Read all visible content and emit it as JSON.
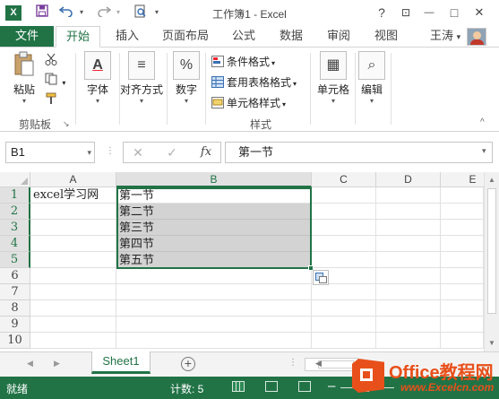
{
  "window": {
    "title": "工作簿1 - Excel",
    "app_icon": "X",
    "help": "?",
    "restore": "⊡",
    "minimize": "—",
    "maximize": "□",
    "close": "✕"
  },
  "ribbon_tabs": {
    "file": "文件",
    "items": [
      "开始",
      "插入",
      "页面布局",
      "公式",
      "数据",
      "审阅",
      "视图"
    ],
    "active": "开始",
    "user": "王涛",
    "user_caret": "▾"
  },
  "ribbon": {
    "clipboard": {
      "paste": "粘贴",
      "group": "剪贴板"
    },
    "font": {
      "label": "字体",
      "icon_text": "A"
    },
    "alignment": {
      "label": "对齐方式",
      "icon_text": "≡"
    },
    "number": {
      "label": "数字",
      "icon_text": "%"
    },
    "styles": {
      "conditional": "条件格式",
      "table": "套用表格格式",
      "cell_styles": "单元格样式",
      "group": "样式"
    },
    "cells": {
      "label": "单元格",
      "icon_text": "▦"
    },
    "editing": {
      "label": "编辑",
      "icon_text": "⌕"
    },
    "collapse": "^"
  },
  "formula_bar": {
    "name_box": "B1",
    "cancel": "✕",
    "enter": "✓",
    "fx": "fx",
    "value": "第一节"
  },
  "grid": {
    "columns": [
      "A",
      "B",
      "C",
      "D",
      "E"
    ],
    "rows": [
      "1",
      "2",
      "3",
      "4",
      "5",
      "6",
      "7",
      "8",
      "9",
      "10"
    ],
    "cells": {
      "A1": "excel学习网",
      "B1": "第一节",
      "B2": "第二节",
      "B3": "第三节",
      "B4": "第四节",
      "B5": "第五节"
    },
    "selection": "B1:B5"
  },
  "sheets": {
    "tabs": [
      "Sheet1"
    ],
    "active": "Sheet1",
    "add": "+"
  },
  "status": {
    "ready": "就绪",
    "count": "计数: 5"
  },
  "watermark": {
    "brand": "Office教程网",
    "url": "www.Excelcn.com"
  }
}
